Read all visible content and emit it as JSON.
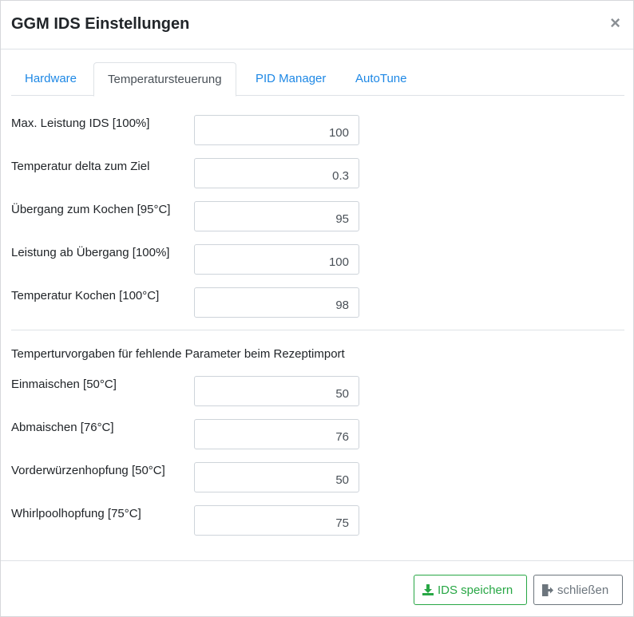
{
  "dialog": {
    "title": "GGM IDS Einstellungen",
    "close_symbol": "×"
  },
  "tabs": [
    {
      "label": "Hardware",
      "active": false
    },
    {
      "label": "Temperatursteuerung",
      "active": true
    },
    {
      "label": "PID Manager",
      "active": false
    },
    {
      "label": "AutoTune",
      "active": false
    }
  ],
  "fields": [
    {
      "label": "Max. Leistung IDS [100%]",
      "value": "100"
    },
    {
      "label": "Temperatur delta zum Ziel",
      "value": "0.3"
    },
    {
      "label": "Übergang zum Kochen [95°C]",
      "value": "95"
    },
    {
      "label": "Leistung ab Übergang [100%]",
      "value": "100"
    },
    {
      "label": "Temperatur Kochen [100°C]",
      "value": "98"
    }
  ],
  "import_section": {
    "heading": "Temperturvorgaben für fehlende Parameter beim Rezeptimport",
    "fields": [
      {
        "label": "Einmaischen [50°C]",
        "value": "50"
      },
      {
        "label": "Abmaischen [76°C]",
        "value": "76"
      },
      {
        "label": "Vorderwürzenhopfung [50°C]",
        "value": "50"
      },
      {
        "label": "Whirlpoolhopfung [75°C]",
        "value": "75"
      }
    ]
  },
  "footer": {
    "save_label": "IDS speichern",
    "save_icon": "download-icon",
    "close_label": "schließen",
    "close_icon": "sign-out-icon"
  },
  "colors": {
    "tab_link": "#1e88e5",
    "save_green": "#28a745",
    "close_gray": "#6c757d"
  }
}
